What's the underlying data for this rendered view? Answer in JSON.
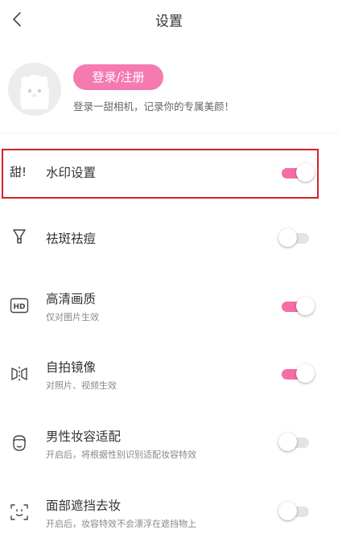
{
  "header": {
    "title": "设置"
  },
  "profile": {
    "login_label": "登录/注册",
    "description": "登录一甜相机，记录你的专属美颜！"
  },
  "settings": [
    {
      "title": "水印设置",
      "subtitle": "",
      "on": true,
      "icon": "watermark-icon",
      "icon_text": "甜!"
    },
    {
      "title": "祛斑祛痘",
      "subtitle": "",
      "on": false,
      "icon": "spot-removal-icon"
    },
    {
      "title": "高清画质",
      "subtitle": "仅对图片生效",
      "on": true,
      "icon": "hd-icon",
      "icon_text": "HD"
    },
    {
      "title": "自拍镜像",
      "subtitle": "对照片、视频生效",
      "on": true,
      "icon": "mirror-icon"
    },
    {
      "title": "男性妆容适配",
      "subtitle": "开启后，将根据性别识别适配妆容特效",
      "on": false,
      "icon": "male-face-icon"
    },
    {
      "title": "面部遮挡去妆",
      "subtitle": "开启后，妆容特效不会漂浮在遮挡物上",
      "on": false,
      "icon": "face-scan-icon"
    }
  ],
  "colors": {
    "accent": "#f57ab0",
    "toggle_on": "#f46ea5",
    "highlight": "#d4202a"
  }
}
